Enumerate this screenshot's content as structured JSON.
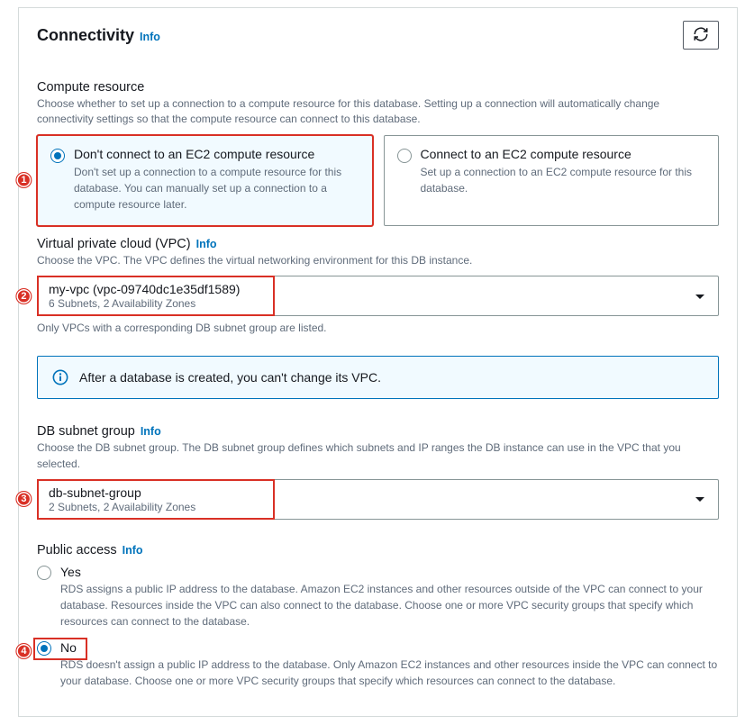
{
  "header": {
    "title": "Connectivity",
    "info": "Info"
  },
  "callouts": {
    "one": "1",
    "two": "2",
    "three": "3",
    "four": "4"
  },
  "compute": {
    "label": "Compute resource",
    "hint": "Choose whether to set up a connection to a compute resource for this database. Setting up a connection will automatically change connectivity settings so that the compute resource can connect to this database.",
    "opt_a_title": "Don't connect to an EC2 compute resource",
    "opt_a_desc": "Don't set up a connection to a compute resource for this database. You can manually set up a connection to a compute resource later.",
    "opt_b_title": "Connect to an EC2 compute resource",
    "opt_b_desc": "Set up a connection to an EC2 compute resource for this database."
  },
  "vpc": {
    "label": "Virtual private cloud (VPC)",
    "info": "Info",
    "hint": "Choose the VPC. The VPC defines the virtual networking environment for this DB instance.",
    "value": "my-vpc (vpc-09740dc1e35df1589)",
    "sub": "6 Subnets, 2 Availability Zones",
    "note": "Only VPCs with a corresponding DB subnet group are listed."
  },
  "alert": {
    "text": "After a database is created, you can't change its VPC."
  },
  "subnet": {
    "label": "DB subnet group",
    "info": "Info",
    "hint": "Choose the DB subnet group. The DB subnet group defines which subnets and IP ranges the DB instance can use in the VPC that you selected.",
    "value": "db-subnet-group",
    "sub": "2 Subnets, 2 Availability Zones"
  },
  "public": {
    "label": "Public access",
    "info": "Info",
    "yes_label": "Yes",
    "yes_desc": "RDS assigns a public IP address to the database. Amazon EC2 instances and other resources outside of the VPC can connect to your database. Resources inside the VPC can also connect to the database. Choose one or more VPC security groups that specify which resources can connect to the database.",
    "no_label": "No",
    "no_desc": "RDS doesn't assign a public IP address to the database. Only Amazon EC2 instances and other resources inside the VPC can connect to your database. Choose one or more VPC security groups that specify which resources can connect to the database."
  }
}
